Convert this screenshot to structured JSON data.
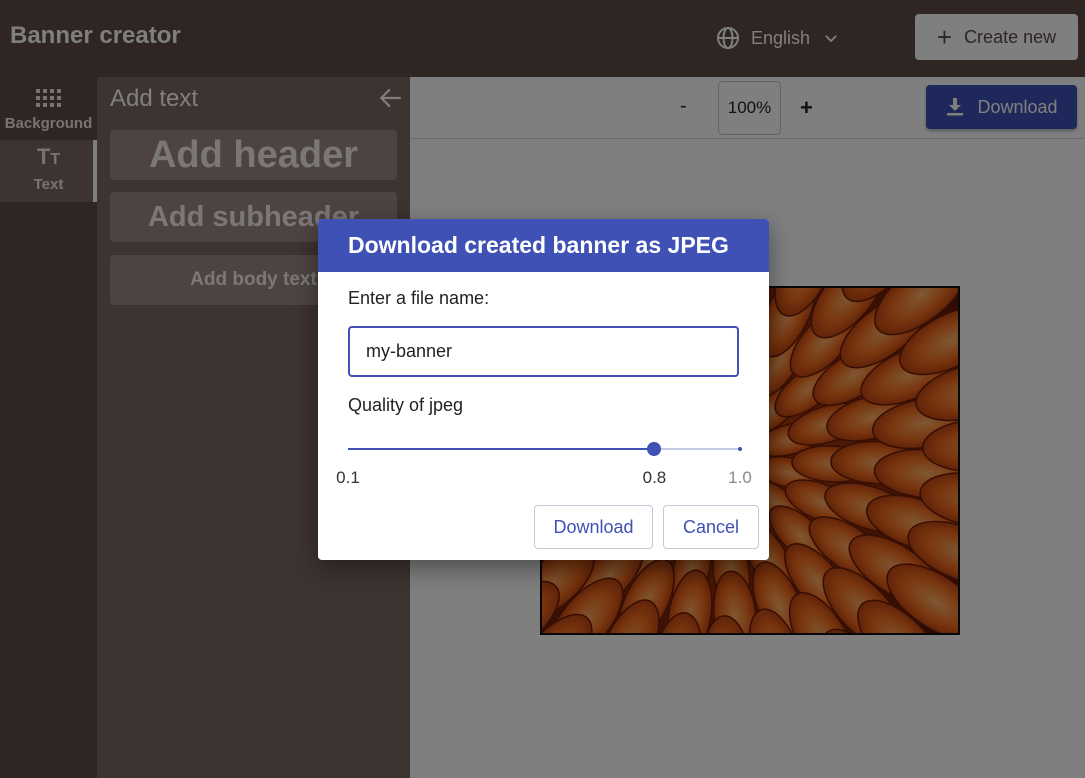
{
  "app": {
    "title": "Banner creator"
  },
  "language": {
    "label": "English",
    "icon": "globe-icon"
  },
  "create_new": {
    "label": "Create new",
    "icon": "plus-icon"
  },
  "rail": {
    "items": [
      {
        "label": "Background",
        "icon": "grid-icon"
      },
      {
        "label": "Text",
        "icon": "text-size-icon"
      }
    ]
  },
  "panel": {
    "title": "Add text",
    "add_header": "Add header",
    "add_subheader": "Add subheader",
    "add_body": "Add body text"
  },
  "toolbar": {
    "zoom_out": "-",
    "zoom": "100%",
    "zoom_in": "+",
    "download": "Download"
  },
  "dialog": {
    "title": "Download created banner as JPEG",
    "file_label": "Enter a file name:",
    "file_value": "my-banner",
    "quality_label": "Quality of jpeg",
    "slider": {
      "min": 0.1,
      "max": 1.0,
      "value": 0.8,
      "min_label": "0.1",
      "value_label": "0.8",
      "max_label": "1.0"
    },
    "download_label": "Download",
    "cancel_label": "Cancel"
  },
  "colors": {
    "brown": "#5e4a47",
    "brown_light": "#7a6662",
    "primary": "#3f51b5",
    "flower": "#e0521a"
  }
}
